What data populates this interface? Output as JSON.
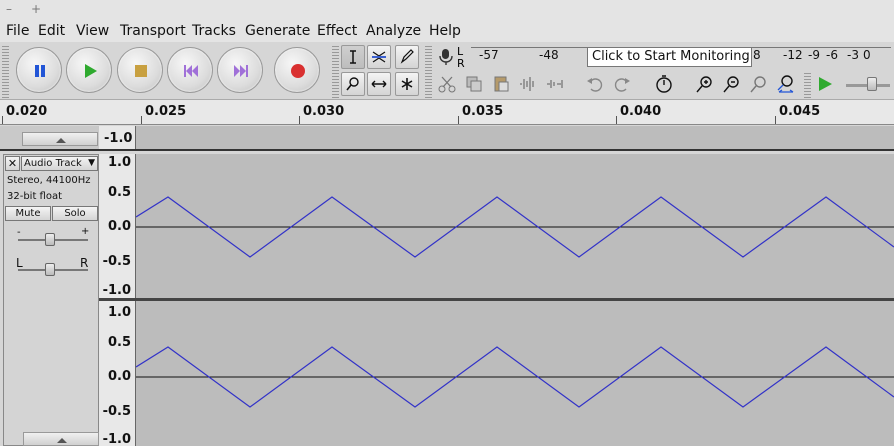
{
  "window": {
    "title_left": "–",
    "title_plus": "+"
  },
  "menu": [
    "File",
    "Edit",
    "View",
    "Transport",
    "Tracks",
    "Generate",
    "Effect",
    "Analyze",
    "Help"
  ],
  "meter": {
    "labels": [
      "-57",
      "-48",
      "8",
      "-12",
      "-9",
      "-6",
      "-3",
      "0"
    ],
    "channel_l": "L",
    "channel_r": "R",
    "tooltip": "Click to Start Monitoring"
  },
  "ruler": {
    "labels": [
      "0.020",
      "0.025",
      "0.030",
      "0.035",
      "0.040",
      "0.045"
    ]
  },
  "top_scale_label": "-1.0",
  "track": {
    "name": "Audio Track",
    "info1": "Stereo, 44100Hz",
    "info2": "32-bit float",
    "mute": "Mute",
    "solo": "Solo",
    "gain_minus": "-",
    "gain_plus": "+",
    "pan_left": "L",
    "pan_right": "R",
    "close": "✕",
    "menu_arrow": "▼"
  },
  "channel_scale": [
    "1.0",
    "0.5",
    "0.0",
    "-0.5",
    "-1.0"
  ],
  "colors": {
    "waveform": "#3232c8",
    "record": "#d93030",
    "play": "#2faa2f",
    "pause": "#2255d6"
  }
}
